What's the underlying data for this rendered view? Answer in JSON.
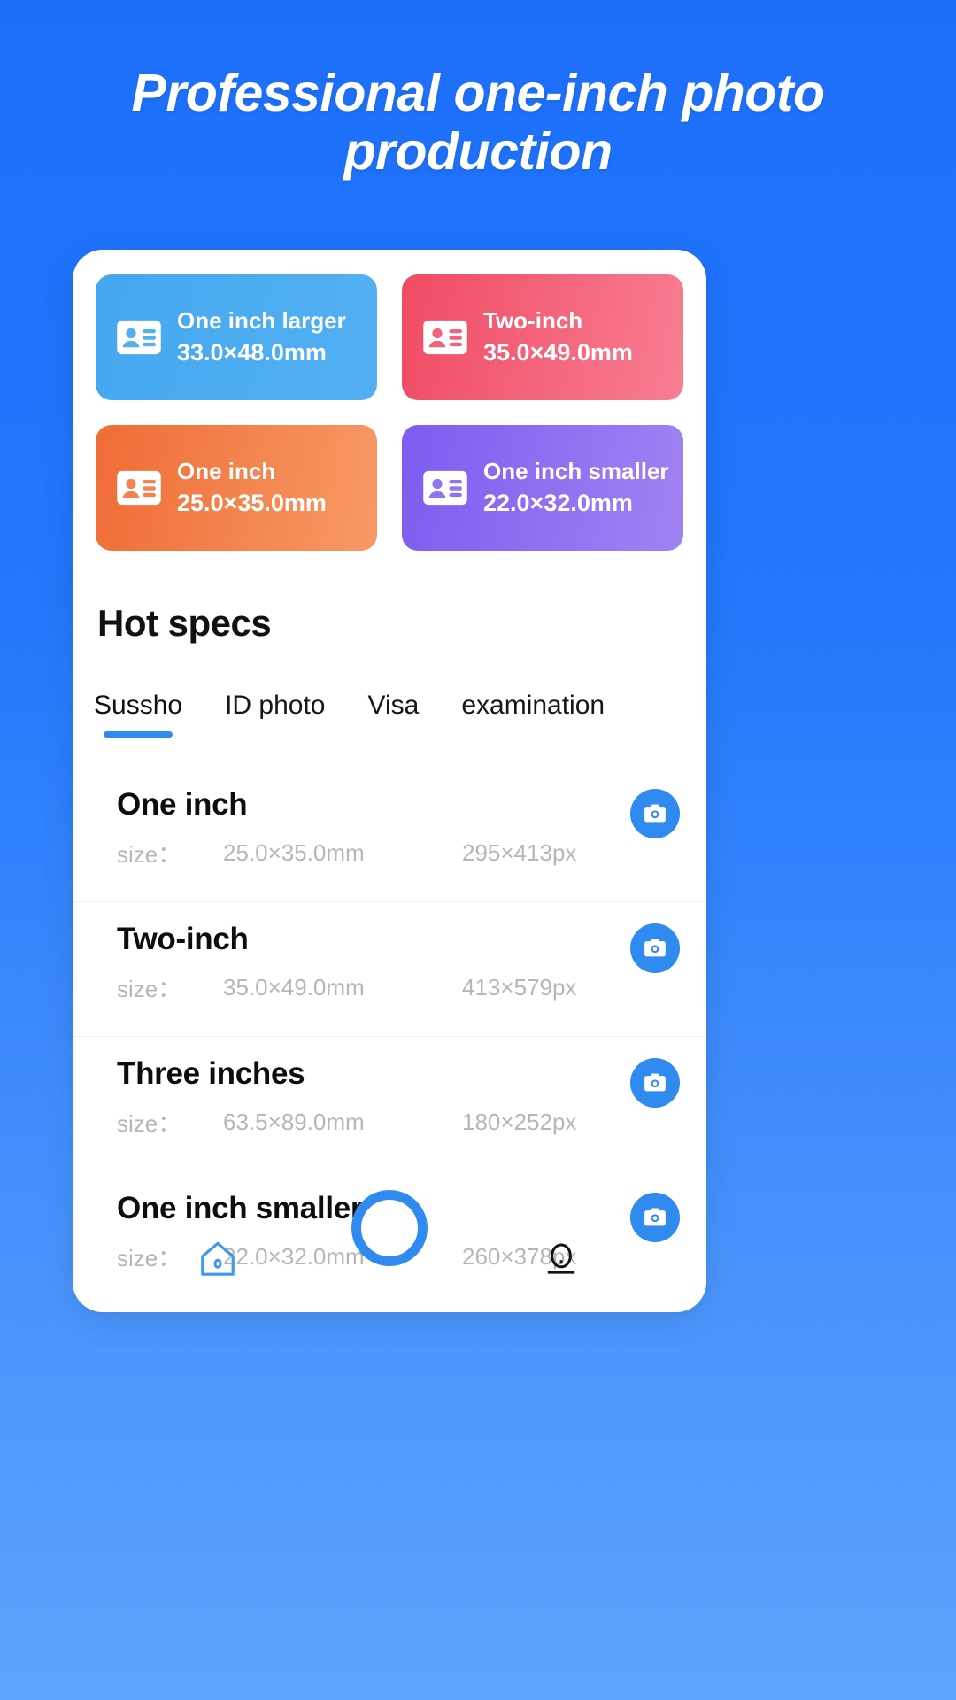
{
  "header": {
    "title": "Professional one-inch photo production"
  },
  "quick_specs": {
    "icon": "id-card-icon",
    "items": [
      {
        "name": "One inch larger",
        "dimensions": "33.0×48.0mm",
        "color": "#45a8ef",
        "theme": "blue"
      },
      {
        "name": "Two-inch",
        "dimensions": "35.0×49.0mm",
        "color": "#ef4c63",
        "theme": "pink"
      },
      {
        "name": "One inch",
        "dimensions": "25.0×35.0mm",
        "color": "#ef6c35",
        "theme": "orange"
      },
      {
        "name": "One inch smaller",
        "dimensions": "22.0×32.0mm",
        "color": "#7d5cf0",
        "theme": "purple"
      }
    ]
  },
  "section": {
    "heading": "Hot specs"
  },
  "tabs": {
    "active_index": 0,
    "accent_color": "#2f8bf0",
    "items": [
      {
        "label": "Sussho"
      },
      {
        "label": "ID photo"
      },
      {
        "label": "Visa"
      },
      {
        "label": "examination"
      }
    ]
  },
  "spec_list": {
    "size_label": "size：",
    "camera_icon": "camera-icon",
    "rows": [
      {
        "name": "One inch",
        "mm": "25.0×35.0mm",
        "px": "295×413px"
      },
      {
        "name": "Two-inch",
        "mm": "35.0×49.0mm",
        "px": "413×579px"
      },
      {
        "name": "Three inches",
        "mm": "63.5×89.0mm",
        "px": "180×252px"
      },
      {
        "name": "One inch smaller",
        "mm": "22.0×32.0mm",
        "px": "260×378px"
      }
    ]
  },
  "bottom_nav": {
    "home_icon": "home-icon",
    "shutter_icon": "shutter-ring-icon",
    "profile_icon": "profile-icon"
  }
}
